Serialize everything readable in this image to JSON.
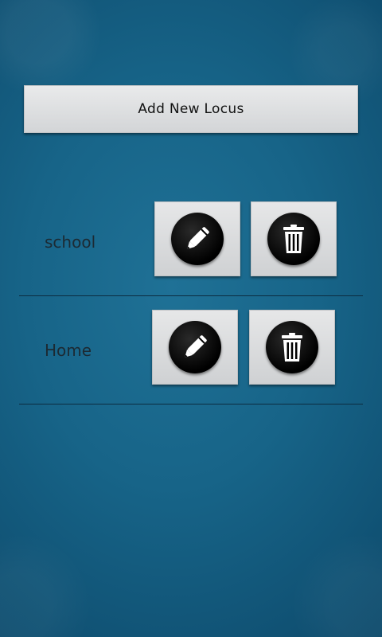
{
  "add_button": {
    "label": "Add New Locus"
  },
  "loci": [
    {
      "name": "school",
      "edit_icon": "pencil-icon",
      "delete_icon": "trash-icon"
    },
    {
      "name": "Home",
      "edit_icon": "pencil-icon",
      "delete_icon": "trash-icon"
    }
  ],
  "colors": {
    "background": "#176488",
    "button": "#e0e1e2",
    "divider": "#0c2c40"
  }
}
